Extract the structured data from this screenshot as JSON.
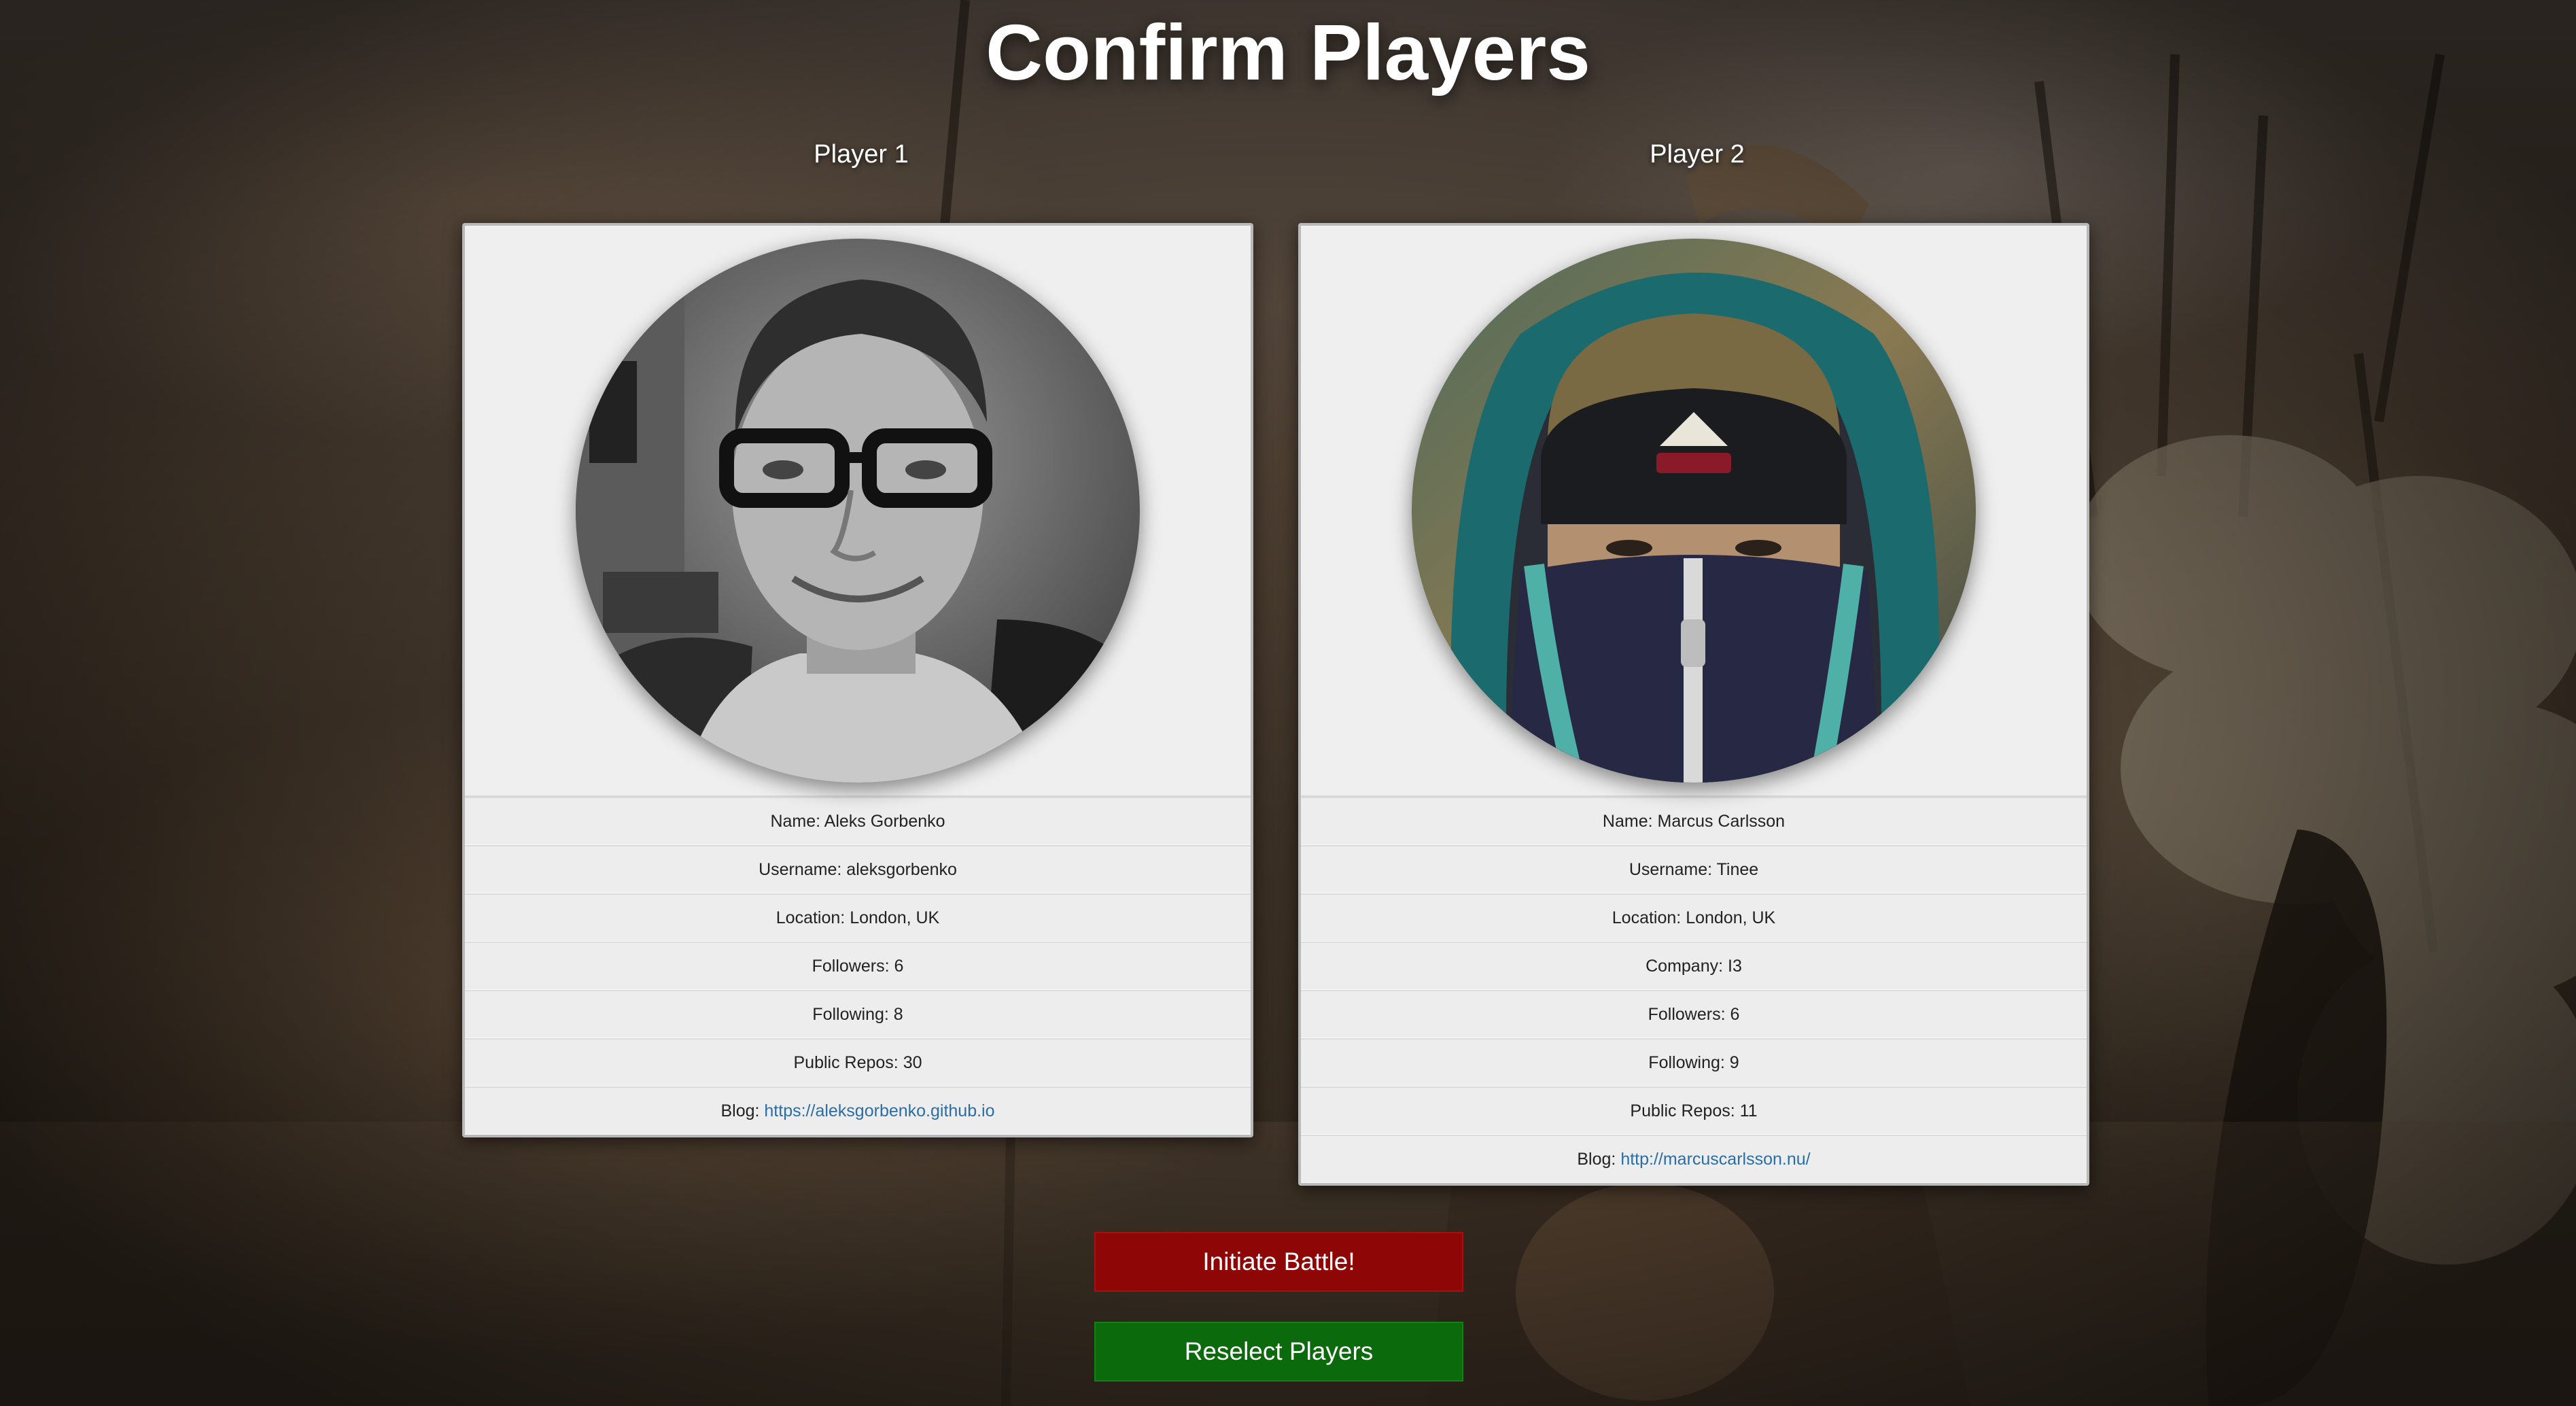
{
  "page": {
    "title": "Confirm Players"
  },
  "players": [
    {
      "heading": "Player 1",
      "avatar_alt": "avatar-player-1",
      "rows": [
        {
          "label": "Name: ",
          "value": "Aleks Gorbenko"
        },
        {
          "label": "Username: ",
          "value": "aleksgorbenko"
        },
        {
          "label": "Location: ",
          "value": "London, UK"
        },
        {
          "label": "Followers: ",
          "value": "6"
        },
        {
          "label": "Following: ",
          "value": "8"
        },
        {
          "label": "Public Repos: ",
          "value": "30"
        }
      ],
      "blog": {
        "label": "Blog: ",
        "url": "https://aleksgorbenko.github.io"
      }
    },
    {
      "heading": "Player 2",
      "avatar_alt": "avatar-player-2",
      "rows": [
        {
          "label": "Name: ",
          "value": "Marcus Carlsson"
        },
        {
          "label": "Username: ",
          "value": "Tinee"
        },
        {
          "label": "Location: ",
          "value": "London, UK"
        },
        {
          "label": "Company: ",
          "value": "I3"
        },
        {
          "label": "Followers: ",
          "value": "6"
        },
        {
          "label": "Following: ",
          "value": "9"
        },
        {
          "label": "Public Repos: ",
          "value": "11"
        }
      ],
      "blog": {
        "label": "Blog: ",
        "url": "http://marcuscarlsson.nu/"
      }
    }
  ],
  "buttons": {
    "initiate_battle": "Initiate Battle!",
    "reselect_players": "Reselect Players"
  },
  "colors": {
    "battle_button": "#8e0606",
    "reselect_button": "#0b6a0b",
    "link": "#2a6ea6",
    "card_background": "#efefef"
  }
}
